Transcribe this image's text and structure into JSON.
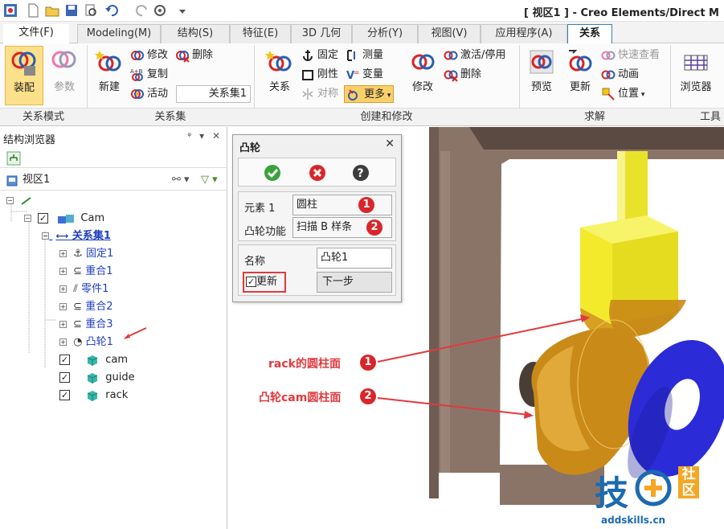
{
  "window": {
    "title": "[ 视区1 ] - Creo Elements/Direct M"
  },
  "quick_access": [
    "app-icon",
    "new-icon",
    "open-icon",
    "save-icon",
    "print-preview-icon",
    "undo-icon",
    "redo-icon",
    "settings-icon",
    "customize-icon"
  ],
  "tabs": [
    {
      "label": "文件(F)"
    },
    {
      "label": "Modeling(M)"
    },
    {
      "label": "结构(S)"
    },
    {
      "label": "特征(E)"
    },
    {
      "label": "3D 几何"
    },
    {
      "label": "分析(Y)"
    },
    {
      "label": "视图(V)"
    },
    {
      "label": "应用程序(A)"
    },
    {
      "label": "关系"
    }
  ],
  "ribbon": {
    "groups": {
      "relation_mode": "关系模式",
      "relation_set": "关系集",
      "create_modify": "创建和修改",
      "solve": "求解",
      "tools": "工具"
    },
    "assemble": "装配",
    "params": "参数",
    "new": "新建",
    "modify_set": "修改",
    "copy": "复制",
    "active": "活动",
    "delete_set": "删除",
    "active_set_value": "关系集1",
    "relation": "关系",
    "fixed": "固定",
    "rigid": "刚性",
    "symmetric": "对称",
    "measure": "测量",
    "variable": "变量",
    "more": "更多",
    "modify": "修改",
    "activate_disable": "激活/停用",
    "delete": "删除",
    "preview": "预览",
    "update": "更新",
    "quick_view": "快速查看",
    "animation": "动画",
    "position": "位置",
    "browser": "浏览器"
  },
  "structure_browser": {
    "title": "结构浏览器",
    "pin_icon": "pin-icon",
    "close_icon": "close-icon",
    "view_label": "视区1",
    "tree": [
      {
        "label": "Cam",
        "checked": true
      },
      {
        "label": "关系集1"
      },
      {
        "label": "固定1"
      },
      {
        "label": "重合1"
      },
      {
        "label": "零件1"
      },
      {
        "label": "重合2"
      },
      {
        "label": "重合3"
      },
      {
        "label": "凸轮1"
      },
      {
        "label": "cam",
        "checked": true
      },
      {
        "label": "guide",
        "checked": true
      },
      {
        "label": "rack",
        "checked": true
      }
    ]
  },
  "cam_dialog": {
    "title": "凸轮",
    "element_label": "元素 1",
    "element_value": "圆柱",
    "function_label": "凸轮功能",
    "function_value": "扫描 B 样条",
    "name_label": "名称",
    "name_value": "凸轮1",
    "update_label": "更新",
    "update_checked": true,
    "next_label": "下一步",
    "badge1": "1",
    "badge2": "2"
  },
  "annotations": {
    "rack_surface": "rack的圆柱面",
    "cam_surface": "凸轮cam圆柱面",
    "badge1": "1",
    "badge2": "2"
  },
  "watermark": {
    "chars": "技",
    "side": "社区",
    "site": "addskills.cn"
  },
  "colors": {
    "accent_red": "#e03a3e",
    "badge_red": "#d9262a",
    "link_blue": "#1f3fbf",
    "part_brown": "#8a7468",
    "rack_yellow": "#f3ea2c",
    "cam_orange": "#c98a17",
    "guide_blue": "#2b2bd8"
  }
}
